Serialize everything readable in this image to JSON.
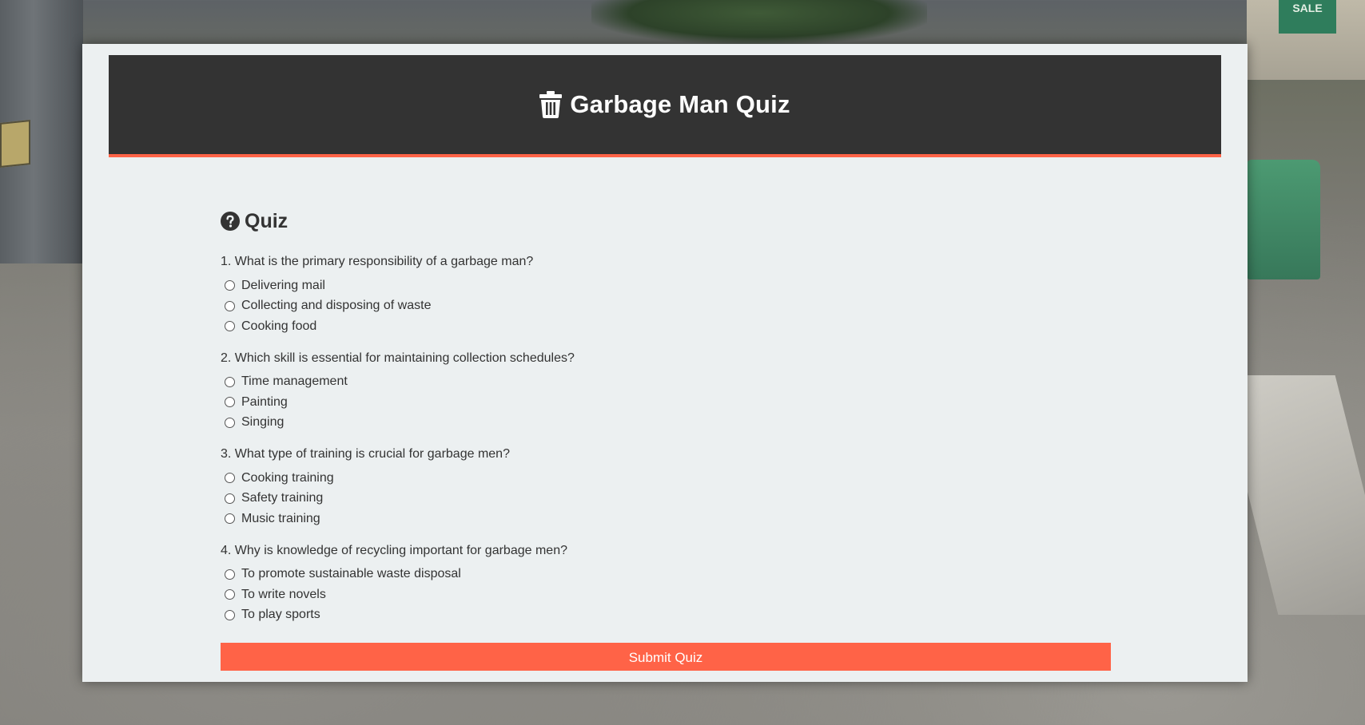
{
  "header": {
    "title": "Garbage Man Quiz",
    "icon": "trash-icon"
  },
  "quiz": {
    "heading": "Quiz",
    "heading_icon": "question-circle-icon",
    "questions": [
      {
        "text": "1. What is the primary responsibility of a garbage man?",
        "options": [
          "Delivering mail",
          "Collecting and disposing of waste",
          "Cooking food"
        ]
      },
      {
        "text": "2. Which skill is essential for maintaining collection schedules?",
        "options": [
          "Time management",
          "Painting",
          "Singing"
        ]
      },
      {
        "text": "3. What type of training is crucial for garbage men?",
        "options": [
          "Cooking training",
          "Safety training",
          "Music training"
        ]
      },
      {
        "text": "4. Why is knowledge of recycling important for garbage men?",
        "options": [
          "To promote sustainable waste disposal",
          "To write novels",
          "To play sports"
        ]
      }
    ],
    "submit_label": "Submit Quiz"
  },
  "background": {
    "store_sign": "SALE"
  },
  "colors": {
    "accent": "#ff6347",
    "header_bg": "#333333",
    "panel_bg": "#ecf0f1",
    "text": "#333333"
  }
}
